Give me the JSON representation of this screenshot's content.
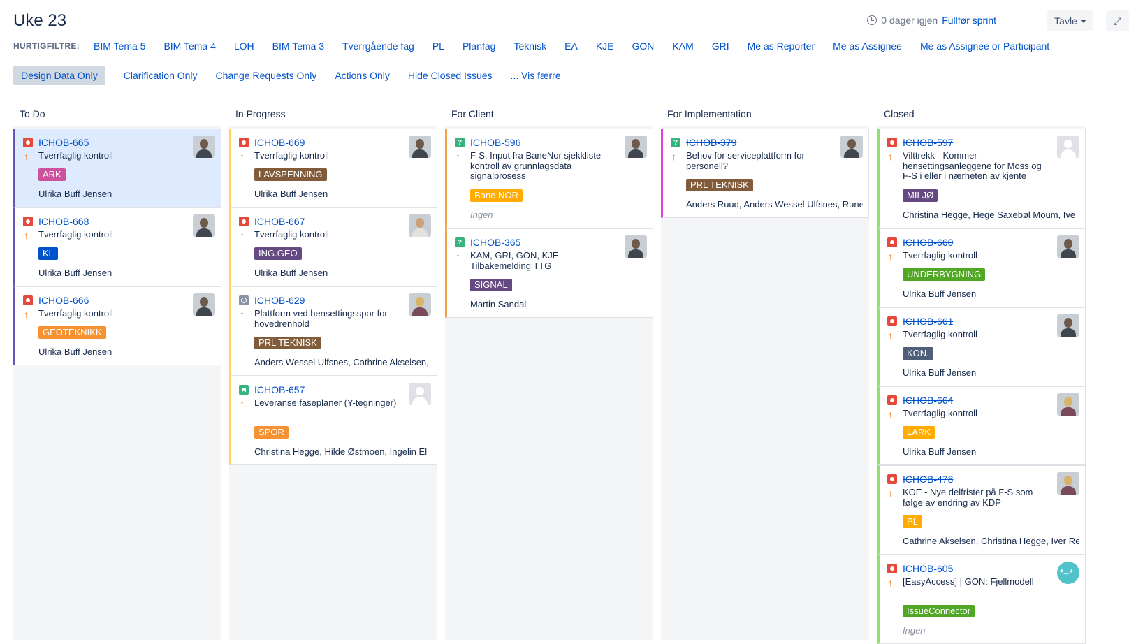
{
  "header": {
    "title": "Uke 23",
    "days_remaining": "0 dager igjen",
    "complete_sprint": "Fullfør sprint",
    "board_menu": "Tavle",
    "clock_icon": "clock-icon",
    "expand_icon": "expand-icon"
  },
  "quickfilters": {
    "label": "HURTIGFILTRE:",
    "row1": [
      "BIM Tema 5",
      "BIM Tema 4",
      "LOH",
      "BIM Tema 3",
      "Tverrgående fag",
      "PL",
      "Planfag",
      "Teknisk",
      "EA",
      "KJE",
      "GON",
      "KAM",
      "GRI",
      "Me as Reporter",
      "Me as Assignee",
      "Me as Assignee or Participant"
    ],
    "row2": [
      "Design Data Only",
      "Clarification Only",
      "Change Requests Only",
      "Actions Only",
      "Hide Closed Issues",
      "... Vis færre"
    ],
    "active": "Design Data Only"
  },
  "colors": {
    "link": "#0052cc",
    "todo_border": "#6554c0",
    "inprogress_border": "#ffd351",
    "forclient_border": "#f6a047",
    "forimpl_border": "#e03ed6",
    "closed_border": "#8ce26d"
  },
  "columns": [
    {
      "name": "To Do",
      "cards": [
        {
          "key": "ICHOB-665",
          "type": "bug",
          "priority": "med",
          "summary": "Tverrfaglig kontroll",
          "label": "ARK",
          "label_color": "#cd519d",
          "assignees": "Ulrika Buff Jensen",
          "avatar": "person",
          "selected": true
        },
        {
          "key": "ICHOB-668",
          "type": "bug",
          "priority": "med",
          "summary": "Tverrfaglig kontroll",
          "label": "KL",
          "label_color": "#0052cc",
          "assignees": "Ulrika Buff Jensen",
          "avatar": "person"
        },
        {
          "key": "ICHOB-666",
          "type": "bug",
          "priority": "med",
          "summary": "Tverrfaglig kontroll",
          "label": "GEOTEKNIKK",
          "label_color": "#f79232",
          "assignees": "Ulrika Buff Jensen",
          "avatar": "person"
        }
      ]
    },
    {
      "name": "In Progress",
      "cards": [
        {
          "key": "ICHOB-669",
          "type": "bug",
          "priority": "med",
          "summary": "Tverrfaglig kontroll",
          "label": "LAVSPENNING",
          "label_color": "#815b3a",
          "assignees": "Ulrika Buff Jensen",
          "avatar": "person"
        },
        {
          "key": "ICHOB-667",
          "type": "bug",
          "priority": "med",
          "summary": "Tverrfaglig kontroll",
          "label": "ING.GEO",
          "label_color": "#654982",
          "assignees": "Ulrika Buff Jensen",
          "avatar": "light"
        },
        {
          "key": "ICHOB-629",
          "type": "task",
          "priority": "high",
          "summary": "Plattform ved hensettingsspor for hovedrenhold",
          "label": "PRL TEKNISK",
          "label_color": "#815b3a",
          "assignees": "Anders Wessel Ulfsnes, Cathrine Akselsen,",
          "avatar": "blonde"
        },
        {
          "key": "ICHOB-657",
          "type": "story",
          "priority": "med",
          "summary": "Leveranse faseplaner (Y-tegninger)",
          "label": "SPOR",
          "label_color": "#f79232",
          "assignees": "Christina Hegge, Hilde Østmoen, Ingelin El",
          "avatar": "placeholder"
        }
      ]
    },
    {
      "name": "For Client",
      "cards": [
        {
          "key": "ICHOB-596",
          "type": "question",
          "priority": "med",
          "summary": "F-S: Input fra BaneNor sjekkliste kontroll av grunnlagsdata signalprosess",
          "label": "Bane NOR",
          "label_color": "#ffab00",
          "assignees": "Ingen",
          "avatar": "person"
        },
        {
          "key": "ICHOB-365",
          "type": "question",
          "priority": "med",
          "summary": "KAM, GRI, GON, KJE Tilbakemelding TTG",
          "label": "SIGNAL",
          "label_color": "#654982",
          "assignees": "Martin Sandal",
          "avatar": "person"
        }
      ]
    },
    {
      "name": "For Implementation",
      "cards": [
        {
          "key": "ICHOB-379",
          "type": "question",
          "priority": "med",
          "summary": "Behov for serviceplattform for personell?",
          "label": "PRL TEKNISK",
          "label_color": "#815b3a",
          "assignees": "Anders Ruud, Anders Wessel Ulfsnes, Rune",
          "avatar": "person",
          "done": true
        }
      ]
    },
    {
      "name": "Closed",
      "cards": [
        {
          "key": "ICHOB-597",
          "type": "bug",
          "priority": "med",
          "summary": "Vilttrekk - Kommer hensettingsanleggene for Moss og F-S i eller i nærheten av kjente",
          "label": "MILJØ",
          "label_color": "#654982",
          "assignees": "Christina Hegge, Hege Saxebøl Moum, Ive",
          "avatar": "placeholder",
          "done": true
        },
        {
          "key": "ICHOB-660",
          "type": "bug",
          "priority": "med",
          "summary": "Tverrfaglig kontroll",
          "label": "UNDERBYGNING",
          "label_color": "#51a825",
          "assignees": "Ulrika Buff Jensen",
          "avatar": "person",
          "done": true
        },
        {
          "key": "ICHOB-661",
          "type": "bug",
          "priority": "med",
          "summary": "Tverrfaglig kontroll",
          "label": "KON.",
          "label_color": "#505f79",
          "assignees": "Ulrika Buff Jensen",
          "avatar": "person",
          "done": true
        },
        {
          "key": "ICHOB-664",
          "type": "bug",
          "priority": "med",
          "summary": "Tverrfaglig kontroll",
          "label": "LARK",
          "label_color": "#ffab00",
          "assignees": "Ulrika Buff Jensen",
          "avatar": "blonde",
          "done": true
        },
        {
          "key": "ICHOB-478",
          "type": "bug",
          "priority": "med",
          "summary": "KOE - Nye delfrister på F-S som følge av endring av KDP",
          "label": "PL",
          "label_color": "#ffab00",
          "assignees": "Cathrine Akselsen, Christina Hegge, Iver Re",
          "avatar": "blonde",
          "done": true
        },
        {
          "key": "ICHOB-605",
          "type": "bug",
          "priority": "med",
          "summary": "[EasyAccess] | GON: Fjellmodell",
          "label": "IssueConnector",
          "label_color": "#51a825",
          "assignees": "Ingen",
          "avatar": "bot",
          "done": true
        }
      ]
    }
  ]
}
